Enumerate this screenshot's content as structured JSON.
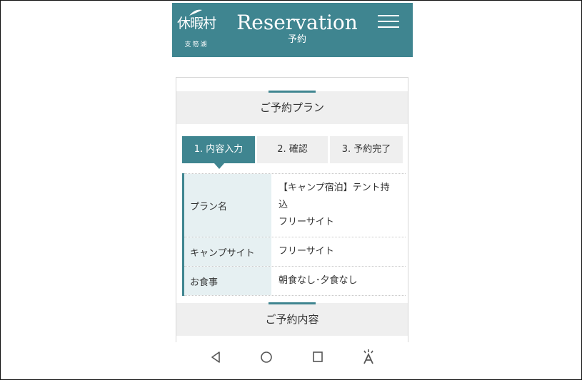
{
  "header": {
    "logo_main": "休暇村",
    "logo_sub": "支笏湖",
    "title_en": "Reservation",
    "title_ja": "予約",
    "menu_icon": "hamburger-menu-icon",
    "color": "#3f8590"
  },
  "plan_section": {
    "heading": "ご予約プラン",
    "steps": [
      {
        "label": "1. 内容入力",
        "active": true
      },
      {
        "label": "2. 確認",
        "active": false
      },
      {
        "label": "3. 予約完了",
        "active": false
      }
    ],
    "rows": [
      {
        "label": "プラン名",
        "value_line1": "【キャンプ宿泊】テント持込",
        "value_line2": "フリーサイト"
      },
      {
        "label": "キャンプサイト",
        "value": "フリーサイト"
      },
      {
        "label": "お食事",
        "value": "朝食なし･夕食なし"
      }
    ]
  },
  "details_section": {
    "heading": "ご予約内容"
  },
  "navbar": {
    "icons": [
      "back-icon",
      "home-icon",
      "recents-icon",
      "accessibility-icon"
    ]
  }
}
